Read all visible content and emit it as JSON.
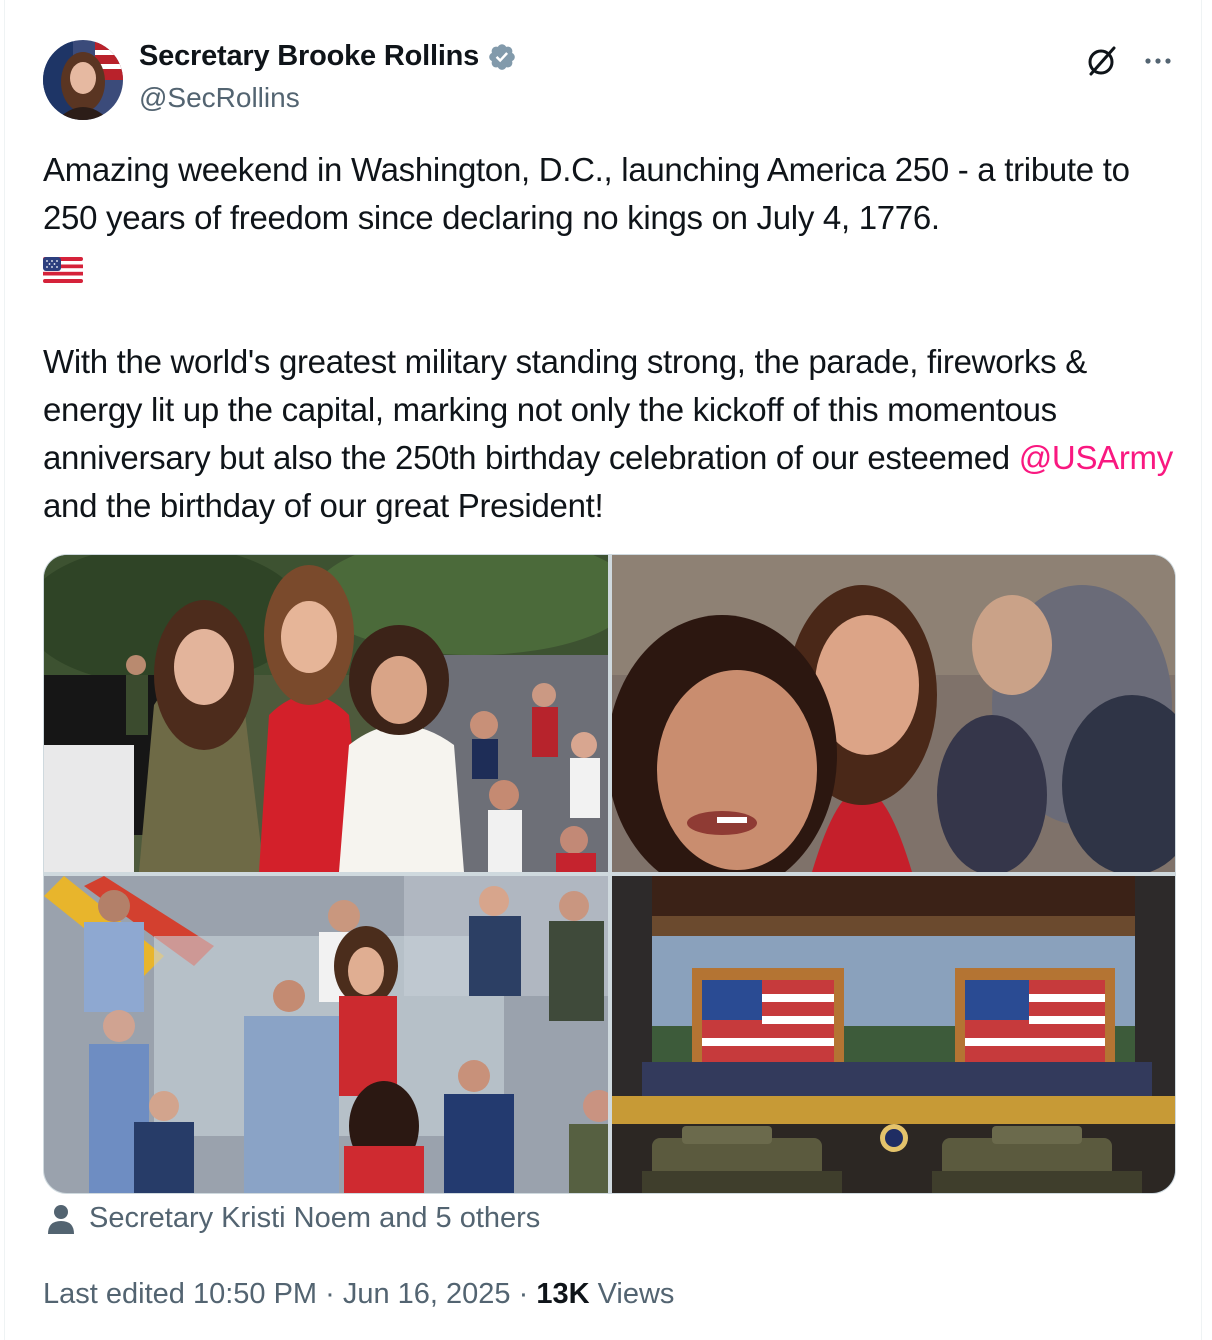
{
  "author": {
    "display_name": "Secretary Brooke Rollins",
    "handle": "@SecRollins",
    "verified_color": "#829aab"
  },
  "tweet": {
    "para1": "Amazing weekend in Washington, D.C., launching America 250 - a tribute to 250 years of freedom since declaring no kings on July 4, 1776.",
    "para2_before": "With the world's greatest military standing strong, the parade, fireworks & energy lit up the capital, marking not only the kickoff of this momentous anniversary but also the 250th birthday celebration of our esteemed ",
    "mention": "@USArmy",
    "para2_after": " and the birthday of our great President!",
    "mention_color": "#f91880"
  },
  "media": {
    "tiles": [
      "photo-three-women-outdoors",
      "photo-selfie-in-crowd",
      "photo-reviewing-stand",
      "photo-stage-with-tanks"
    ]
  },
  "tagged": {
    "text": "Secretary Kristi Noem and 5 others"
  },
  "meta": {
    "edited": "Last edited 10:50 PM · Jun 16, 2025 · ",
    "views_count": "13K",
    "views_label": " Views"
  },
  "icons": {
    "avatar": "avatar",
    "verified": "verified-badge-icon",
    "grok": "grok-icon",
    "more": "more-icon",
    "flag": "us-flag-emoji",
    "person": "person-icon"
  }
}
